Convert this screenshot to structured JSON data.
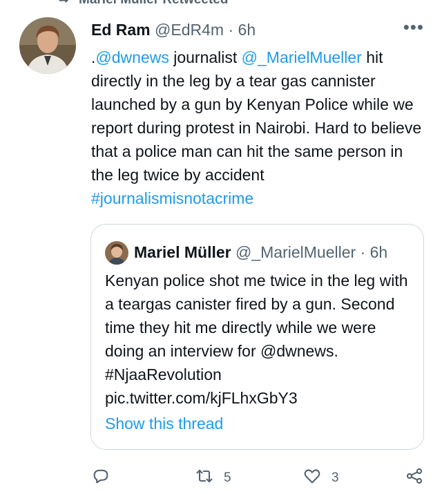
{
  "retweet_banner": {
    "text": "Mariel Müller Retweeted"
  },
  "tweet": {
    "name": "Ed Ram",
    "handle": "@EdR4m",
    "separator": " · ",
    "time": "6h",
    "more_label": "•••",
    "text": {
      "prefix": ".",
      "mention1": "@dwnews",
      "part1": " journalist ",
      "mention2": "@_MarielMueller",
      "part2": " hit directly in the leg by a tear gas cannister launched by a gun by Kenyan Police while we report during protest in Nairobi. Hard to believe that a police man can hit the same person in the leg twice by accident ",
      "hashtag": "#journalismisnotacrime"
    }
  },
  "quoted": {
    "name": "Mariel Müller",
    "handle": "@_MarielMueller",
    "separator": " · ",
    "time": "6h",
    "text": "Kenyan police shot me twice in the leg with a teargas canister fired by a gun. Second time they hit me directly while we were doing an interview for @dwnews. #NjaaRevolution pic.twitter.com/kjFLhxGbY3",
    "show_thread": "Show this thread"
  },
  "actions": {
    "reply_count": "",
    "retweet_count": "5",
    "like_count": "3"
  },
  "colors": {
    "link": "#1d9bf0",
    "muted": "#536471",
    "border": "#cfd9de"
  }
}
